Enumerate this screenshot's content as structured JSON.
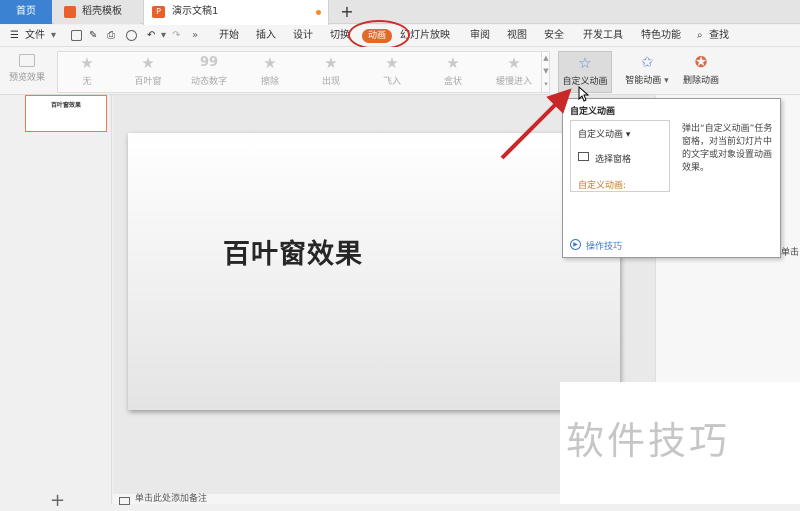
{
  "tabs": {
    "home": "首页",
    "template": "稻壳模板",
    "document": "演示文稿1",
    "add": "+"
  },
  "menu": {
    "file": "文件",
    "items": [
      "开始",
      "插入",
      "设计",
      "切换",
      "动画",
      "幻灯片放映",
      "审阅",
      "视图",
      "安全",
      "开发工具",
      "特色功能"
    ],
    "search": "查找"
  },
  "ribbon": {
    "preview": "预览效果",
    "gallery": [
      "无",
      "百叶窗",
      "动态数字",
      "擦除",
      "出现",
      "飞入",
      "盒状",
      "缓慢进入"
    ],
    "custom_animation": "自定义动画",
    "smart_animation": "智能动画",
    "delete_animation": "删除动画"
  },
  "slide": {
    "thumbnail_text": "百叶窗效果",
    "title": "百叶窗效果",
    "notes_placeholder": "单击此处添加备注"
  },
  "popup": {
    "title": "自定义动画",
    "dropdown": "自定义动画",
    "select_pane": "选择窗格",
    "section_label": "自定义动画:",
    "description": "弹出“自定义动画”任务窗格，对当前幻灯片中的文字或对象设置动画效果。",
    "tips": "操作技巧"
  },
  "right_pane": {
    "tail_text": "单击"
  },
  "watermark": "软件技巧",
  "colors": {
    "accent": "#3c82d2",
    "animation_tab": "#e06a2a",
    "highlight_ellipse": "#cc2e2e",
    "tips_link": "#3d79c8"
  }
}
